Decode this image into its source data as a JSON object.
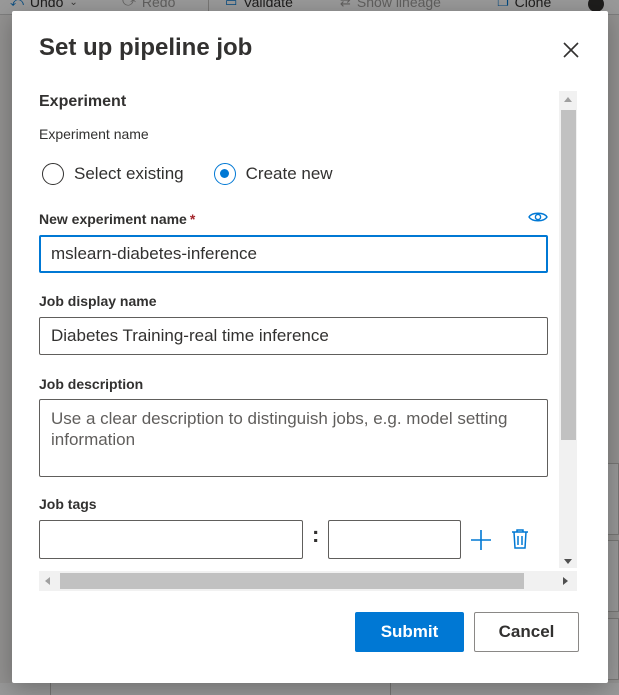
{
  "background": {
    "toolbar": {
      "undo_label": "Undo",
      "redo_label": "Redo",
      "validate_label": "Validate",
      "show_lineage_label": "Show lineage",
      "clone_label": "Clone"
    }
  },
  "dialog": {
    "title": "Set up pipeline job",
    "close_icon": "close-icon",
    "section_title": "Experiment",
    "experiment_name_label": "Experiment name",
    "radio_options": [
      {
        "label": "Select existing",
        "checked": false
      },
      {
        "label": "Create new",
        "checked": true
      }
    ],
    "new_experiment_label": "New experiment name",
    "required_marker": "*",
    "new_experiment_value": "mslearn-diabetes-inference",
    "eye_icon": "eye-icon",
    "job_display_name_label": "Job display name",
    "job_display_name_value": "Diabetes Training-real time inference",
    "job_description_label": "Job description",
    "job_description_placeholder": "Use a clear description to distinguish jobs, e.g. model setting information",
    "job_tags_label": "Job tags",
    "tag_separator": ":",
    "add_icon": "add-icon",
    "delete_icon": "delete-icon",
    "submit_label": "Submit",
    "cancel_label": "Cancel"
  },
  "colors": {
    "accent": "#0078d4",
    "required": "#a4262c",
    "text": "#323130"
  }
}
